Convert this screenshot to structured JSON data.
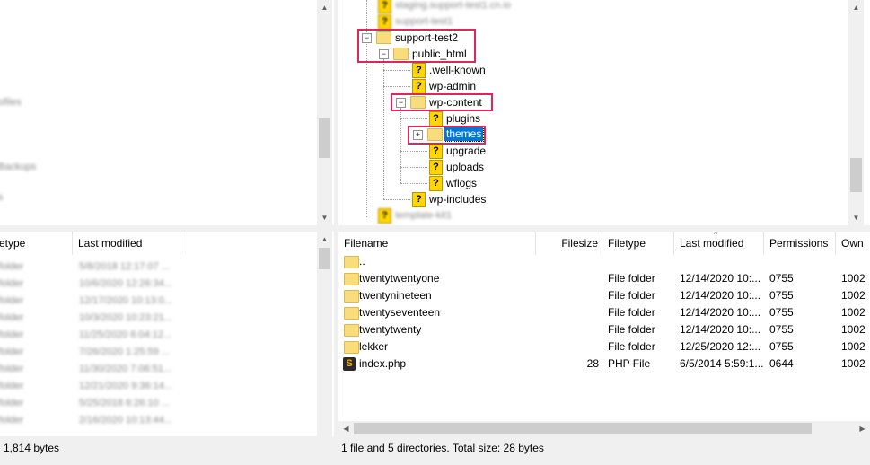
{
  "remote_tree": {
    "items": [
      {
        "label": "staging.support-test1.cn.io",
        "blurred": true
      },
      {
        "label": "support-test1",
        "blurred": true
      },
      {
        "label": "support-test2",
        "icon": "folder-icon",
        "expander": "−"
      },
      {
        "label": "public_html",
        "icon": "folder-icon",
        "expander": "−"
      },
      {
        "label": ".well-known",
        "icon": "question-icon"
      },
      {
        "label": "wp-admin",
        "icon": "question-icon"
      },
      {
        "label": "wp-content",
        "icon": "folder-icon",
        "expander": "−"
      },
      {
        "label": "plugins",
        "icon": "question-icon"
      },
      {
        "label": "themes",
        "icon": "folder-icon",
        "expander": "+",
        "selected": true
      },
      {
        "label": "upgrade",
        "icon": "question-icon"
      },
      {
        "label": "uploads",
        "icon": "question-icon"
      },
      {
        "label": "wflogs",
        "icon": "question-icon"
      },
      {
        "label": "wp-includes",
        "icon": "question-icon"
      },
      {
        "label": "template-kit1",
        "blurred": true
      }
    ]
  },
  "local_tree": {
    "blurred_items": [
      "ofiles",
      "Backups",
      "s"
    ]
  },
  "local_list": {
    "columns": [
      "etype",
      "Last modified"
    ],
    "rows": [
      {
        "type": "File folder",
        "modified": "5/8/2018 12:17:07 ..."
      },
      {
        "type": "File folder",
        "modified": "10/6/2020 12:26:34..."
      },
      {
        "type": "File folder",
        "modified": "12/17/2020 10:13:0..."
      },
      {
        "type": "File folder",
        "modified": "10/3/2020 10:23:21..."
      },
      {
        "type": "File folder",
        "modified": "11/25/2020 6:04:12..."
      },
      {
        "type": "File folder",
        "modified": "7/26/2020 1:25:59 ..."
      },
      {
        "type": "File folder",
        "modified": "11/30/2020 7:06:51..."
      },
      {
        "type": "File folder",
        "modified": "12/21/2020 9:36:14..."
      },
      {
        "type": "File folder",
        "modified": "5/25/2018 6:26:10 ..."
      },
      {
        "type": "File folder",
        "modified": "2/16/2020 10:13:44..."
      }
    ],
    "status": "1,814 bytes"
  },
  "remote_list": {
    "columns": [
      "Filename",
      "Filesize",
      "Filetype",
      "Last modified",
      "Permissions",
      "Own"
    ],
    "rows": [
      {
        "name": "..",
        "size": "",
        "type": "",
        "modified": "",
        "perms": "",
        "owner": "",
        "icon": "folder-icon"
      },
      {
        "name": "twentytwentyone",
        "size": "",
        "type": "File folder",
        "modified": "12/14/2020 10:...",
        "perms": "0755",
        "owner": "1002",
        "icon": "folder-icon"
      },
      {
        "name": "twentynineteen",
        "size": "",
        "type": "File folder",
        "modified": "12/14/2020 10:...",
        "perms": "0755",
        "owner": "1002",
        "icon": "folder-icon"
      },
      {
        "name": "twentyseventeen",
        "size": "",
        "type": "File folder",
        "modified": "12/14/2020 10:...",
        "perms": "0755",
        "owner": "1002",
        "icon": "folder-icon"
      },
      {
        "name": "twentytwenty",
        "size": "",
        "type": "File folder",
        "modified": "12/14/2020 10:...",
        "perms": "0755",
        "owner": "1002",
        "icon": "folder-icon"
      },
      {
        "name": "lekker",
        "size": "",
        "type": "File folder",
        "modified": "12/25/2020 12:...",
        "perms": "0755",
        "owner": "1002",
        "icon": "folder-icon"
      },
      {
        "name": "index.php",
        "size": "28",
        "type": "PHP File",
        "modified": "6/5/2014 5:59:1...",
        "perms": "0644",
        "owner": "1002",
        "icon": "php-file-icon"
      }
    ],
    "status": "1 file and 5 directories. Total size: 28 bytes"
  },
  "colors": {
    "highlight": "#e0245e",
    "selection": "#0078d7",
    "folder": "#f9dc7b"
  }
}
